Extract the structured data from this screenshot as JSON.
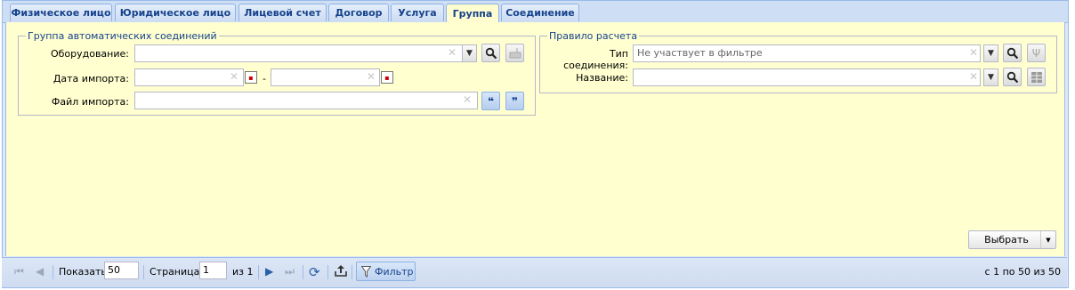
{
  "tabs": [
    {
      "label": "Физическое лицо"
    },
    {
      "label": "Юридическое лицо"
    },
    {
      "label": "Лицевой счет"
    },
    {
      "label": "Договор"
    },
    {
      "label": "Услуга"
    },
    {
      "label": "Группа",
      "active": true
    },
    {
      "label": "Соединение"
    }
  ],
  "group_fieldset": {
    "legend": "Группа автоматических соединений",
    "equipment_label": "Оборудование:",
    "equipment_value": "",
    "import_date_label": "Дата импорта:",
    "date_from": "",
    "date_dash": "-",
    "date_to": "",
    "import_file_label": "Файл импорта:",
    "import_file_value": ""
  },
  "calc_fieldset": {
    "legend": "Правило расчета",
    "conn_type_label": "Тип соединения:",
    "conn_type_value": "Не участвует в фильтре",
    "name_label": "Название:",
    "name_value": ""
  },
  "select_button": {
    "label": "Выбрать"
  },
  "pager": {
    "show_label": "Показать",
    "page_size": "50",
    "page_label": "Страница",
    "page": "1",
    "of_label": "из 1",
    "filter_label": "Фильтр",
    "range_label": "с 1 по 50 из 50"
  },
  "icons": {
    "first": "first-page-icon",
    "prev": "prev-page-icon",
    "next": "next-page-icon",
    "last": "last-page-icon",
    "refresh": "refresh-icon",
    "export": "export-icon",
    "filter": "filter-icon"
  },
  "colors": {
    "panel_background": "#ffffd0",
    "tab_text": "#15428b",
    "border": "#99bbe8"
  }
}
